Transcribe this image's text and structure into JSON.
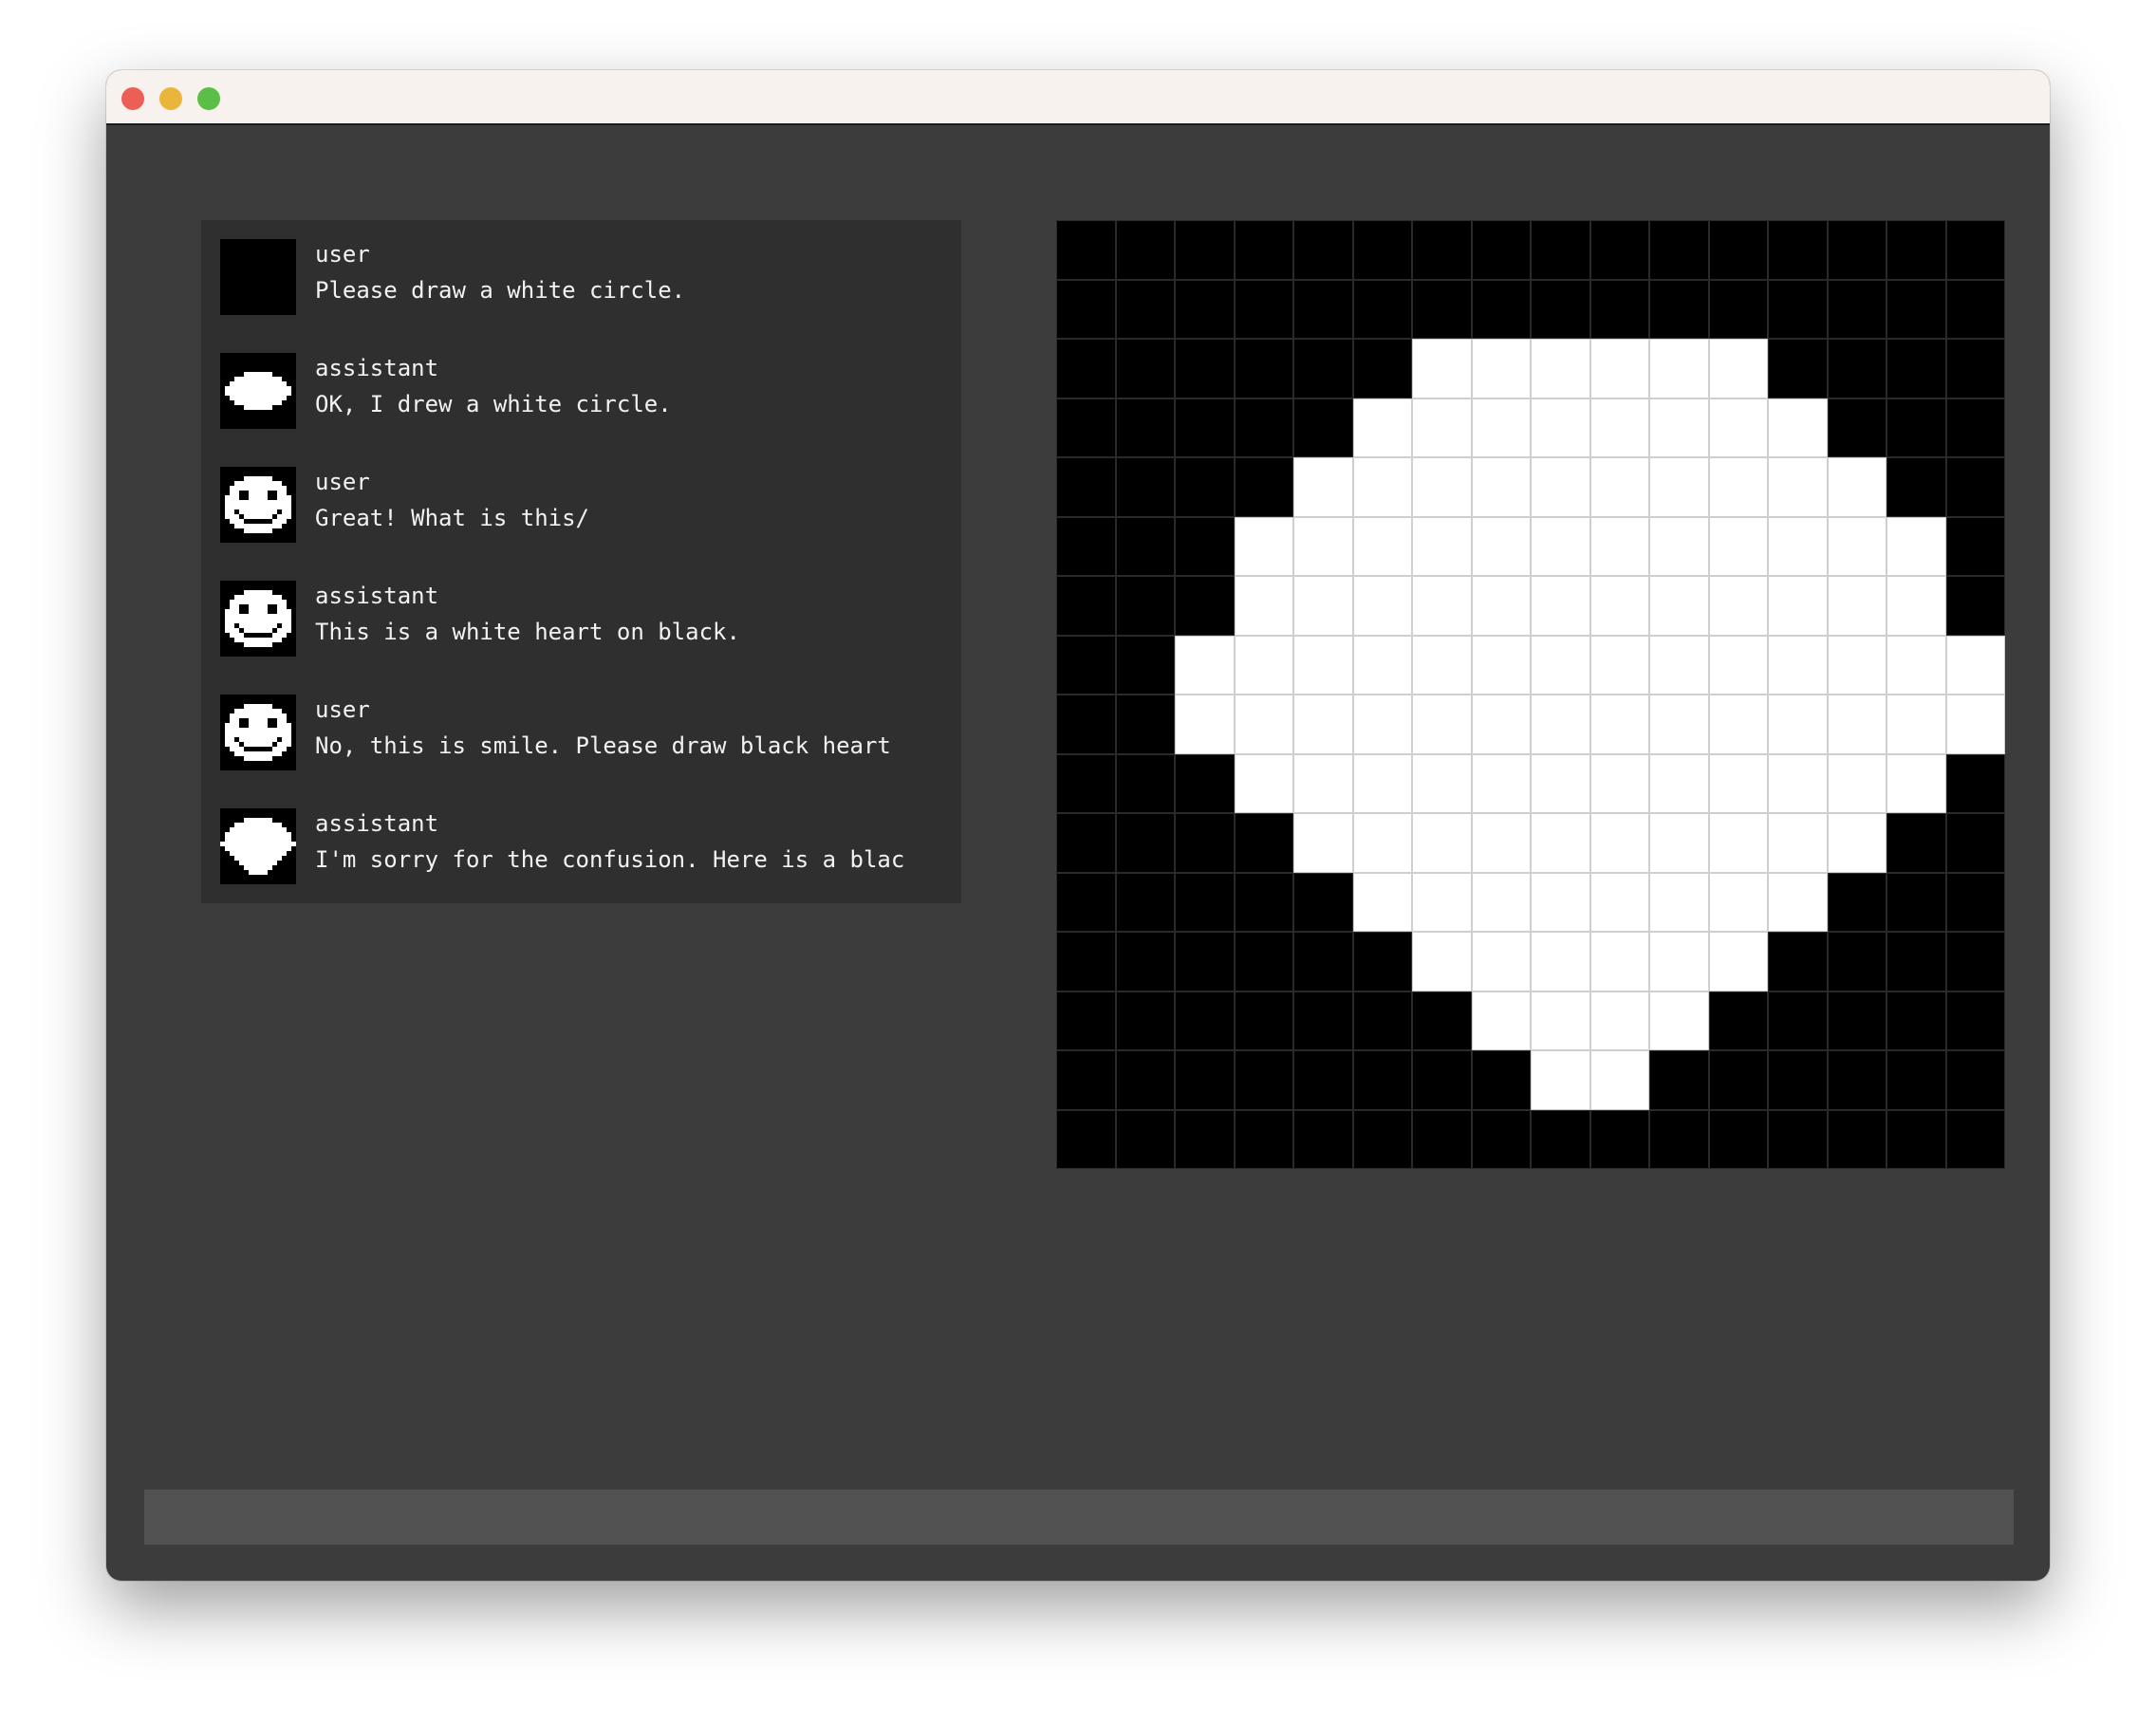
{
  "window": {
    "traffic_lights": [
      "close",
      "minimize",
      "maximize"
    ]
  },
  "messages": [
    {
      "role": "user",
      "text": "Please draw a white circle.",
      "avatar": "blank"
    },
    {
      "role": "assistant",
      "text": "OK, I drew a white circle.",
      "avatar": "circle"
    },
    {
      "role": "user",
      "text": "Great! What is this/",
      "avatar": "smile"
    },
    {
      "role": "assistant",
      "text": "This is a white heart on black.",
      "avatar": "smile"
    },
    {
      "role": "user",
      "text": "No, this is smile. Please draw black heart",
      "avatar": "smile"
    },
    {
      "role": "assistant",
      "text": "I'm sorry for the confusion. Here is a blac",
      "avatar": "heart"
    }
  ],
  "canvas": {
    "grid_size": 16,
    "colors": {
      "on": "#ffffff",
      "off": "#000000"
    },
    "rows": [
      "0000000000000000",
      "0000000000000000",
      "0000001111110000",
      "0000011111111000",
      "0000111111111100",
      "0001111111111110",
      "0001111111111110",
      "0011111111111111",
      "0011111111111111",
      "0001111111111110",
      "0000111111111100",
      "0000011111111000",
      "0000001111110000",
      "0000000111100000",
      "0000000011000000",
      "0000000000000000"
    ]
  },
  "avatars": {
    "blank": [
      "0000000000000000",
      "0000000000000000",
      "0000000000000000",
      "0000000000000000",
      "0000000000000000",
      "0000000000000000",
      "0000000000000000",
      "0000000000000000",
      "0000000000000000",
      "0000000000000000",
      "0000000000000000",
      "0000000000000000",
      "0000000000000000",
      "0000000000000000",
      "0000000000000000",
      "0000000000000000"
    ],
    "circle": [
      "0000000000000000",
      "0000000000000000",
      "0000000000000000",
      "0000000000000000",
      "0000011111100000",
      "0001111111111000",
      "0011111111111100",
      "0111111111111110",
      "0111111111111110",
      "0011111111111100",
      "0001111111111000",
      "0000011111100000",
      "0000000000000000",
      "0000000000000000",
      "0000000000000000",
      "0000000000000000"
    ],
    "smile": [
      "0000000000000000",
      "0000000000000000",
      "0000011111100000",
      "0001111111111000",
      "0011111111111100",
      "0011001111001100",
      "0111001111001110",
      "0111111111111110",
      "0111111111111110",
      "0110111111110110",
      "0111011111101110",
      "0011100000011100",
      "0001111111111000",
      "0000011111100000",
      "0000000000000000",
      "0000000000000000"
    ],
    "heart": [
      "0000000000000000",
      "0000000000000000",
      "0000011111100000",
      "0001111111111000",
      "0011111111111100",
      "0111111111111110",
      "0111111111111110",
      "1111111111111111",
      "0111111111111110",
      "0011111111111100",
      "0001111111111000",
      "0000111111110000",
      "0000011111100000",
      "0000001111000000",
      "0000000000000000",
      "0000000000000000"
    ]
  },
  "input": {
    "value": ""
  }
}
